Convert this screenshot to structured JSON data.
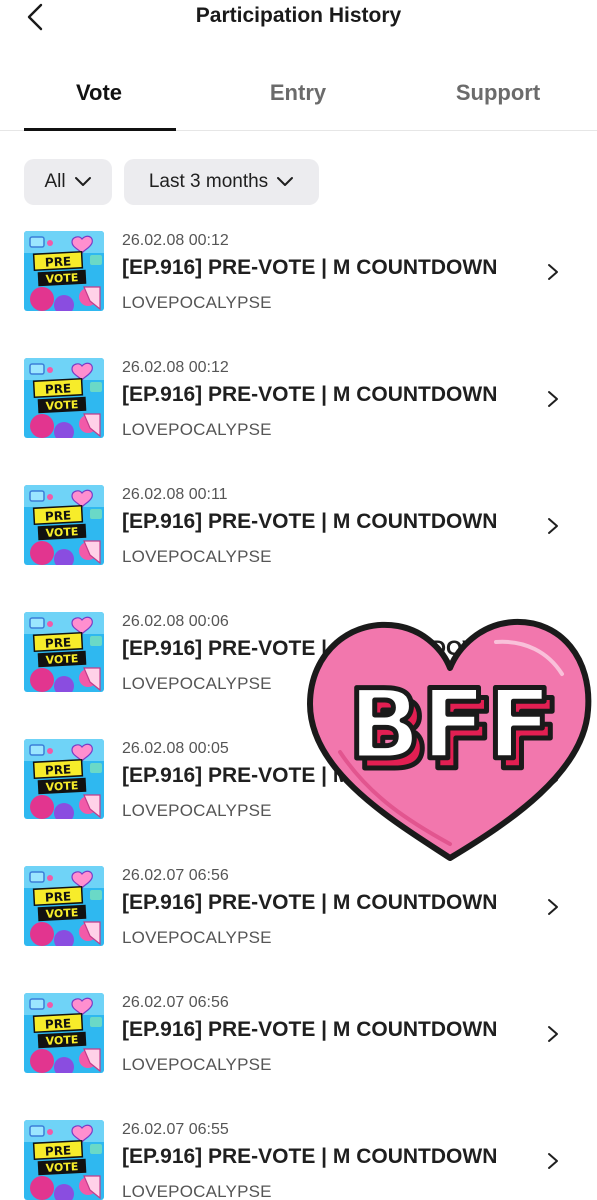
{
  "header": {
    "title": "Participation History"
  },
  "tabs": [
    {
      "label": "Vote"
    },
    {
      "label": "Entry"
    },
    {
      "label": "Support"
    }
  ],
  "filters": {
    "type": "All",
    "period": "Last 3 months"
  },
  "thumbnail": {
    "line1": "PRE",
    "line2": "VOTE"
  },
  "items": [
    {
      "date": "26.02.08 00:12",
      "title": "[EP.916] PRE-VOTE | M COUNTDOWN",
      "artist": "LOVEPOCALYPSE"
    },
    {
      "date": "26.02.08 00:12",
      "title": "[EP.916] PRE-VOTE | M COUNTDOWN",
      "artist": "LOVEPOCALYPSE"
    },
    {
      "date": "26.02.08 00:11",
      "title": "[EP.916] PRE-VOTE | M COUNTDOWN",
      "artist": "LOVEPOCALYPSE"
    },
    {
      "date": "26.02.08 00:06",
      "title": "[EP.916] PRE-VOTE | M COUNTDOWN",
      "artist": "LOVEPOCALYPSE"
    },
    {
      "date": "26.02.08 00:05",
      "title": "[EP.916] PRE-VOTE | M COUNTDOWN",
      "artist": "LOVEPOCALYPSE"
    },
    {
      "date": "26.02.07 06:56",
      "title": "[EP.916] PRE-VOTE | M COUNTDOWN",
      "artist": "LOVEPOCALYPSE"
    },
    {
      "date": "26.02.07 06:56",
      "title": "[EP.916] PRE-VOTE | M COUNTDOWN",
      "artist": "LOVEPOCALYPSE"
    },
    {
      "date": "26.02.07 06:55",
      "title": "[EP.916] PRE-VOTE | M COUNTDOWN",
      "artist": "LOVEPOCALYPSE"
    }
  ],
  "sticker": {
    "text": "BFF"
  },
  "icons": {
    "back": "chevron-left-icon",
    "dropdown": "chevron-down-icon",
    "row_arrow": "chevron-right-icon"
  },
  "colors": {
    "heart_pink": "#f277ad",
    "heart_outline": "#1a1a1a",
    "bff_red": "#e21f52",
    "thumb_sky": "#2fb8f0",
    "thumb_yellow": "#f7ec2a"
  }
}
